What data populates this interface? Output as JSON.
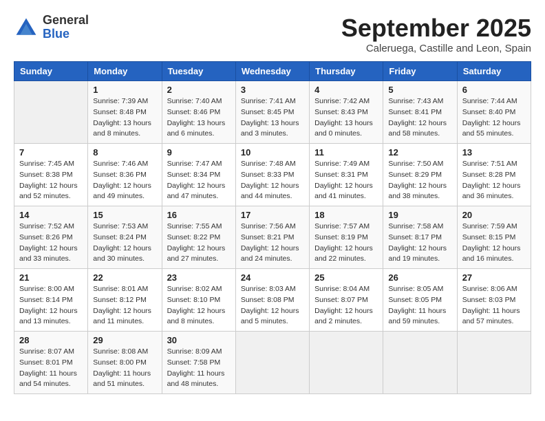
{
  "header": {
    "logo_general": "General",
    "logo_blue": "Blue",
    "month": "September 2025",
    "location": "Caleruega, Castille and Leon, Spain"
  },
  "weekdays": [
    "Sunday",
    "Monday",
    "Tuesday",
    "Wednesday",
    "Thursday",
    "Friday",
    "Saturday"
  ],
  "weeks": [
    [
      {
        "day": "",
        "info": ""
      },
      {
        "day": "1",
        "info": "Sunrise: 7:39 AM\nSunset: 8:48 PM\nDaylight: 13 hours\nand 8 minutes."
      },
      {
        "day": "2",
        "info": "Sunrise: 7:40 AM\nSunset: 8:46 PM\nDaylight: 13 hours\nand 6 minutes."
      },
      {
        "day": "3",
        "info": "Sunrise: 7:41 AM\nSunset: 8:45 PM\nDaylight: 13 hours\nand 3 minutes."
      },
      {
        "day": "4",
        "info": "Sunrise: 7:42 AM\nSunset: 8:43 PM\nDaylight: 13 hours\nand 0 minutes."
      },
      {
        "day": "5",
        "info": "Sunrise: 7:43 AM\nSunset: 8:41 PM\nDaylight: 12 hours\nand 58 minutes."
      },
      {
        "day": "6",
        "info": "Sunrise: 7:44 AM\nSunset: 8:40 PM\nDaylight: 12 hours\nand 55 minutes."
      }
    ],
    [
      {
        "day": "7",
        "info": "Sunrise: 7:45 AM\nSunset: 8:38 PM\nDaylight: 12 hours\nand 52 minutes."
      },
      {
        "day": "8",
        "info": "Sunrise: 7:46 AM\nSunset: 8:36 PM\nDaylight: 12 hours\nand 49 minutes."
      },
      {
        "day": "9",
        "info": "Sunrise: 7:47 AM\nSunset: 8:34 PM\nDaylight: 12 hours\nand 47 minutes."
      },
      {
        "day": "10",
        "info": "Sunrise: 7:48 AM\nSunset: 8:33 PM\nDaylight: 12 hours\nand 44 minutes."
      },
      {
        "day": "11",
        "info": "Sunrise: 7:49 AM\nSunset: 8:31 PM\nDaylight: 12 hours\nand 41 minutes."
      },
      {
        "day": "12",
        "info": "Sunrise: 7:50 AM\nSunset: 8:29 PM\nDaylight: 12 hours\nand 38 minutes."
      },
      {
        "day": "13",
        "info": "Sunrise: 7:51 AM\nSunset: 8:28 PM\nDaylight: 12 hours\nand 36 minutes."
      }
    ],
    [
      {
        "day": "14",
        "info": "Sunrise: 7:52 AM\nSunset: 8:26 PM\nDaylight: 12 hours\nand 33 minutes."
      },
      {
        "day": "15",
        "info": "Sunrise: 7:53 AM\nSunset: 8:24 PM\nDaylight: 12 hours\nand 30 minutes."
      },
      {
        "day": "16",
        "info": "Sunrise: 7:55 AM\nSunset: 8:22 PM\nDaylight: 12 hours\nand 27 minutes."
      },
      {
        "day": "17",
        "info": "Sunrise: 7:56 AM\nSunset: 8:21 PM\nDaylight: 12 hours\nand 24 minutes."
      },
      {
        "day": "18",
        "info": "Sunrise: 7:57 AM\nSunset: 8:19 PM\nDaylight: 12 hours\nand 22 minutes."
      },
      {
        "day": "19",
        "info": "Sunrise: 7:58 AM\nSunset: 8:17 PM\nDaylight: 12 hours\nand 19 minutes."
      },
      {
        "day": "20",
        "info": "Sunrise: 7:59 AM\nSunset: 8:15 PM\nDaylight: 12 hours\nand 16 minutes."
      }
    ],
    [
      {
        "day": "21",
        "info": "Sunrise: 8:00 AM\nSunset: 8:14 PM\nDaylight: 12 hours\nand 13 minutes."
      },
      {
        "day": "22",
        "info": "Sunrise: 8:01 AM\nSunset: 8:12 PM\nDaylight: 12 hours\nand 11 minutes."
      },
      {
        "day": "23",
        "info": "Sunrise: 8:02 AM\nSunset: 8:10 PM\nDaylight: 12 hours\nand 8 minutes."
      },
      {
        "day": "24",
        "info": "Sunrise: 8:03 AM\nSunset: 8:08 PM\nDaylight: 12 hours\nand 5 minutes."
      },
      {
        "day": "25",
        "info": "Sunrise: 8:04 AM\nSunset: 8:07 PM\nDaylight: 12 hours\nand 2 minutes."
      },
      {
        "day": "26",
        "info": "Sunrise: 8:05 AM\nSunset: 8:05 PM\nDaylight: 11 hours\nand 59 minutes."
      },
      {
        "day": "27",
        "info": "Sunrise: 8:06 AM\nSunset: 8:03 PM\nDaylight: 11 hours\nand 57 minutes."
      }
    ],
    [
      {
        "day": "28",
        "info": "Sunrise: 8:07 AM\nSunset: 8:01 PM\nDaylight: 11 hours\nand 54 minutes."
      },
      {
        "day": "29",
        "info": "Sunrise: 8:08 AM\nSunset: 8:00 PM\nDaylight: 11 hours\nand 51 minutes."
      },
      {
        "day": "30",
        "info": "Sunrise: 8:09 AM\nSunset: 7:58 PM\nDaylight: 11 hours\nand 48 minutes."
      },
      {
        "day": "",
        "info": ""
      },
      {
        "day": "",
        "info": ""
      },
      {
        "day": "",
        "info": ""
      },
      {
        "day": "",
        "info": ""
      }
    ]
  ]
}
